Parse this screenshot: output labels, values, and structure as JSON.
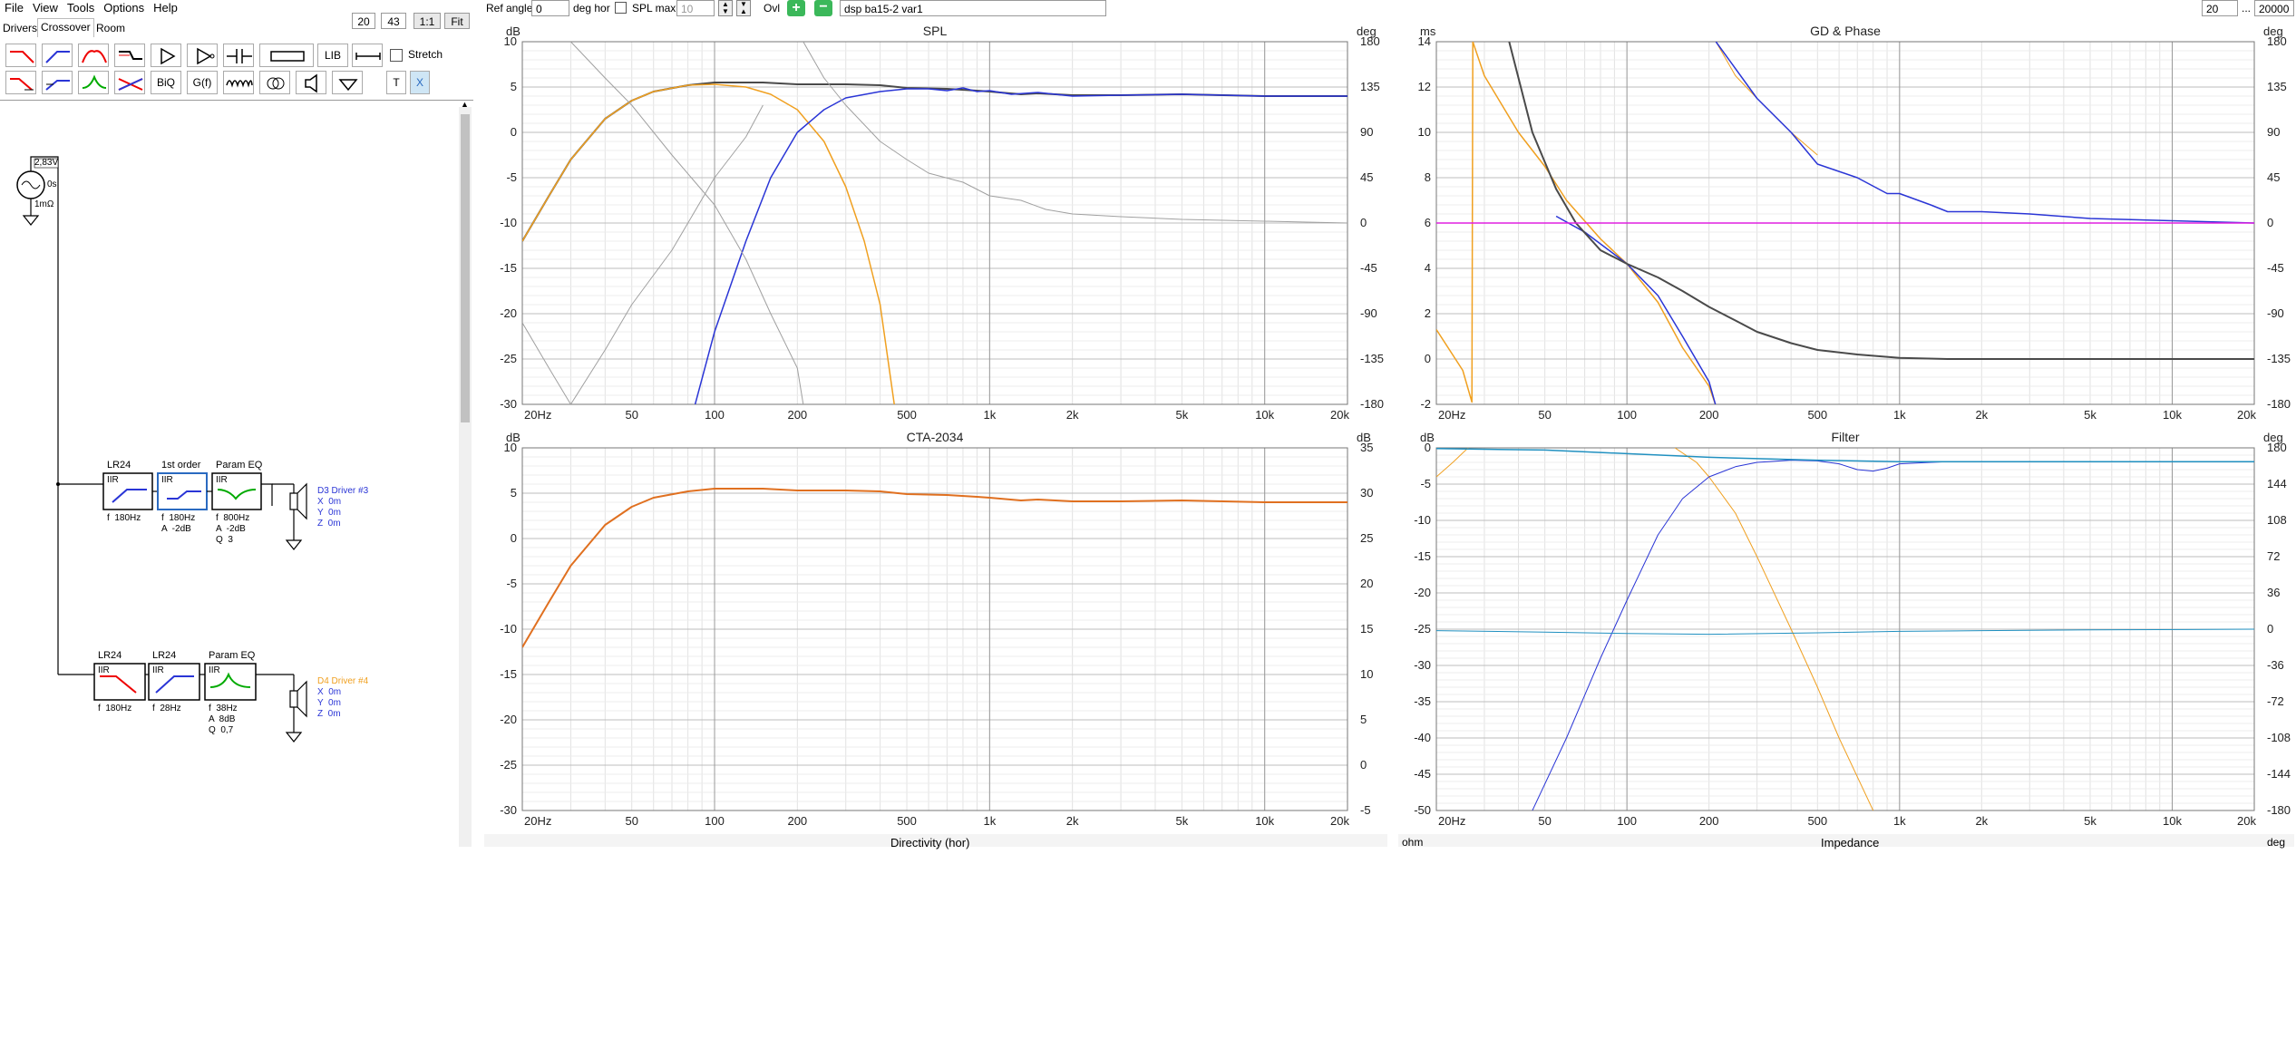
{
  "menu": [
    "File",
    "View",
    "Tools",
    "Options",
    "Help"
  ],
  "tabs": [
    "Drivers",
    "Crossover",
    "Room"
  ],
  "active_tab": "Crossover",
  "zoom": {
    "v1": "20",
    "v2": "43",
    "one_to_one": "1:1",
    "fit": "Fit"
  },
  "toolbar": {
    "lib": "LIB",
    "biq": "BiQ",
    "gf": "G(f)",
    "t": "T",
    "x": "X",
    "stretch": "Stretch"
  },
  "source": {
    "voltage": "2,83V",
    "delay": "0s",
    "resistance": "1mΩ"
  },
  "branch1": {
    "blocks": [
      {
        "title": "LR24",
        "type": "IIR",
        "p1": "f  180Hz",
        "p2": "",
        "p3": ""
      },
      {
        "title": "1st order",
        "type": "IIR",
        "p1": "f  180Hz",
        "p2": "A  -2dB",
        "p3": ""
      },
      {
        "title": "Param EQ",
        "type": "IIR",
        "p1": "f  800Hz",
        "p2": "A  -2dB",
        "p3": "Q  3"
      }
    ],
    "driver": {
      "name": "D3 Driver #3",
      "x": "X  0m",
      "y": "Y  0m",
      "z": "Z  0m",
      "color": "#2a35d6"
    }
  },
  "branch2": {
    "blocks": [
      {
        "title": "LR24",
        "type": "IIR",
        "p1": "f  180Hz",
        "p2": "",
        "p3": ""
      },
      {
        "title": "LR24",
        "type": "IIR",
        "p1": "f  28Hz",
        "p2": "",
        "p3": ""
      },
      {
        "title": "Param EQ",
        "type": "IIR",
        "p1": "f  38Hz",
        "p2": "A  8dB",
        "p3": "Q  0,7"
      }
    ],
    "driver": {
      "name": "D4 Driver #4",
      "x": "X  0m",
      "y": "Y  0m",
      "z": "Z  0m",
      "color": "#f0a020"
    }
  },
  "topbar": {
    "ref_angle_label": "Ref angle",
    "ref_angle_value": "0",
    "deg_hor": "deg hor",
    "spl_max": "SPL max",
    "spl_max_value": "10",
    "ovl": "Ovl",
    "project": "dsp ba15-2 var1",
    "f_min": "20",
    "ellipsis": "...",
    "f_max": "20000"
  },
  "bottom_titles": {
    "directivity": "Directivity (hor)",
    "impedance": "Impedance",
    "ohm": "ohm",
    "deg": "deg"
  },
  "colors": {
    "dark": "#4a4a4a",
    "blue": "#2a35d6",
    "orange": "#f0a020",
    "grey": "#a0a0a0",
    "ctaorange": "#e07020",
    "magenta": "#e020e0",
    "teal": "#2090c0",
    "navy": "#2a2a90"
  },
  "chart_data": [
    {
      "title": "SPL",
      "type": "line",
      "log_x": true,
      "xlim": [
        20,
        20000
      ],
      "ylim": [
        -30,
        10
      ],
      "y2lim": [
        -180,
        180
      ],
      "left_unit": "dB",
      "right_unit": "deg",
      "x_ticks": [
        "20Hz",
        "50",
        "100",
        "200",
        "500",
        "1k",
        "2k",
        "5k",
        "10k",
        "20k"
      ],
      "y_ticks": [
        "10",
        "5",
        "0",
        "-5",
        "-10",
        "-15",
        "-20",
        "-25",
        "-30"
      ],
      "y2_ticks": [
        "180",
        "135",
        "90",
        "45",
        "0",
        "-45",
        "-90",
        "-135",
        "-180"
      ],
      "series": [
        {
          "color": "#4a4a4a",
          "width": 2,
          "x": [
            20,
            25,
            30,
            40,
            50,
            60,
            80,
            100,
            150,
            200,
            300,
            400,
            500,
            700,
            900,
            1000,
            1300,
            1500,
            2000,
            3000,
            5000,
            10000,
            20000
          ],
          "y": [
            -12,
            -7,
            -3,
            1.5,
            3.5,
            4.5,
            5.2,
            5.5,
            5.5,
            5.3,
            5.3,
            5.2,
            4.9,
            4.8,
            4.6,
            4.5,
            4.2,
            4.3,
            4.1,
            4.1,
            4.2,
            4,
            4
          ]
        },
        {
          "color": "#f0a020",
          "width": 1.5,
          "x": [
            20,
            25,
            30,
            40,
            50,
            60,
            80,
            100,
            130,
            160,
            200,
            250,
            300,
            350,
            400,
            450
          ],
          "y": [
            -12,
            -7,
            -3,
            1.5,
            3.5,
            4.5,
            5.2,
            5.3,
            5,
            4.2,
            2.5,
            -1,
            -6,
            -12,
            -19,
            -30
          ]
        },
        {
          "color": "#2a35d6",
          "width": 1.5,
          "x": [
            85,
            100,
            130,
            160,
            200,
            250,
            300,
            400,
            500,
            600,
            700,
            800,
            900,
            1000,
            1200,
            1500,
            2000,
            3000,
            5000,
            10000,
            20000
          ],
          "y": [
            -30,
            -22,
            -12,
            -5,
            0,
            2.5,
            3.8,
            4.5,
            4.8,
            4.8,
            4.6,
            4.9,
            4.5,
            4.6,
            4.2,
            4.4,
            4.0,
            4.1,
            4.2,
            4,
            4
          ]
        },
        {
          "color": "#a0a0a0",
          "width": 1,
          "x": [
            20,
            25,
            30,
            40,
            50,
            70,
            100,
            130,
            150
          ],
          "y": [
            -21,
            -26,
            -30,
            -24,
            -19,
            -13,
            -5,
            -0.5,
            3
          ]
        },
        {
          "color": "#a0a0a0",
          "width": 1,
          "x": [
            30,
            40,
            50,
            70,
            100,
            130,
            160,
            200,
            210
          ],
          "y": [
            10,
            6,
            3,
            -2.5,
            -8,
            -14,
            -20,
            -26,
            -30
          ]
        },
        {
          "color": "#a0a0a0",
          "width": 1,
          "x": [
            210,
            250,
            300,
            400,
            500,
            600,
            800,
            1000,
            1300,
            1600,
            2000,
            3000,
            5000,
            10000,
            20000
          ],
          "y": [
            10,
            6,
            3,
            -1,
            -3,
            -4.5,
            -5.5,
            -7,
            -7.5,
            -8.5,
            -9,
            -9.3,
            -9.6,
            -9.8,
            -10
          ]
        }
      ]
    },
    {
      "title": "GD & Phase",
      "type": "line",
      "log_x": true,
      "xlim": [
        20,
        20000
      ],
      "ylim": [
        -2,
        14
      ],
      "y2lim": [
        -180,
        180
      ],
      "left_unit": "ms",
      "right_unit": "deg",
      "x_ticks": [
        "20Hz",
        "50",
        "100",
        "200",
        "500",
        "1k",
        "2k",
        "5k",
        "10k",
        "20k"
      ],
      "y_ticks": [
        "14",
        "12",
        "10",
        "8",
        "6",
        "4",
        "2",
        "0",
        "-2"
      ],
      "y2_ticks": [
        "180",
        "135",
        "90",
        "45",
        "0",
        "-45",
        "-90",
        "-135",
        "-180"
      ],
      "series": [
        {
          "color": "#f0a020",
          "width": 1.5,
          "x": [
            20,
            25,
            27,
            27.2,
            30,
            40,
            50,
            60,
            80,
            100,
            130,
            160,
            200,
            211
          ],
          "y": [
            1.3,
            -0.5,
            -1.9,
            14,
            12.5,
            10,
            8.5,
            7,
            5.3,
            4.2,
            2.5,
            0.5,
            -1.2,
            -2
          ]
        },
        {
          "color": "#f0a020",
          "width": 1,
          "x": [
            212,
            250,
            300,
            400,
            500
          ],
          "y": [
            14,
            12.5,
            11.5,
            10,
            9
          ]
        },
        {
          "color": "#2a35d6",
          "width": 1.5,
          "x": [
            55,
            70,
            100,
            130,
            160,
            200,
            211
          ],
          "y": [
            6.3,
            5.6,
            4.2,
            2.8,
            1,
            -1,
            -2
          ]
        },
        {
          "color": "#2a35d6",
          "width": 1.5,
          "x": [
            212,
            300,
            400,
            500,
            700,
            900,
            1000,
            1300,
            1500,
            2000,
            3000,
            5000,
            10000,
            20000
          ],
          "y": [
            14,
            11.5,
            10,
            8.6,
            8,
            7.3,
            7.3,
            6.8,
            6.5,
            6.5,
            6.4,
            6.2,
            6.1,
            6
          ]
        },
        {
          "color": "#4a4a4a",
          "width": 2,
          "x": [
            37,
            45,
            55,
            65,
            80,
            100,
            130,
            160,
            200,
            250,
            300,
            400,
            500,
            700,
            1000,
            1500,
            2000,
            5000,
            20000
          ],
          "y": [
            14,
            10,
            7.5,
            6,
            4.8,
            4.2,
            3.6,
            3,
            2.3,
            1.7,
            1.2,
            0.7,
            0.4,
            0.2,
            0.05,
            0,
            0,
            0,
            0
          ]
        },
        {
          "color": "#e020e0",
          "width": 1.5,
          "x": [
            20,
            20000
          ],
          "y": [
            6,
            6
          ]
        }
      ]
    },
    {
      "title": "CTA-2034",
      "type": "line",
      "log_x": true,
      "xlim": [
        20,
        20000
      ],
      "ylim": [
        -30,
        10
      ],
      "y2lim": [
        -5,
        35
      ],
      "left_unit": "dB",
      "right_unit": "dB",
      "x_ticks": [
        "20Hz",
        "50",
        "100",
        "200",
        "500",
        "1k",
        "2k",
        "5k",
        "10k",
        "20k"
      ],
      "y_ticks": [
        "10",
        "5",
        "0",
        "-5",
        "-10",
        "-15",
        "-20",
        "-25",
        "-30"
      ],
      "y2_ticks": [
        "35",
        "30",
        "25",
        "20",
        "15",
        "10",
        "5",
        "0",
        "-5"
      ],
      "series": [
        {
          "color": "#e07020",
          "width": 2,
          "x": [
            20,
            25,
            30,
            40,
            50,
            60,
            80,
            100,
            150,
            200,
            300,
            400,
            500,
            700,
            900,
            1000,
            1300,
            1500,
            2000,
            3000,
            5000,
            10000,
            20000
          ],
          "y": [
            -12,
            -7,
            -3,
            1.5,
            3.5,
            4.5,
            5.2,
            5.5,
            5.5,
            5.3,
            5.3,
            5.2,
            4.9,
            4.8,
            4.6,
            4.5,
            4.2,
            4.3,
            4.1,
            4.1,
            4.2,
            4,
            4
          ]
        }
      ]
    },
    {
      "title": "Filter",
      "type": "line",
      "log_x": true,
      "xlim": [
        20,
        20000
      ],
      "ylim": [
        -50,
        0
      ],
      "y2lim": [
        -180,
        180
      ],
      "left_unit": "dB",
      "right_unit": "deg",
      "x_ticks": [
        "20Hz",
        "50",
        "100",
        "200",
        "500",
        "1k",
        "2k",
        "5k",
        "10k",
        "20k"
      ],
      "y_ticks": [
        "0",
        "-5",
        "-10",
        "-15",
        "-20",
        "-25",
        "-30",
        "-35",
        "-40",
        "-45",
        "-50"
      ],
      "y2_ticks": [
        "180",
        "144",
        "108",
        "72",
        "36",
        "0",
        "-36",
        "-72",
        "-108",
        "-144",
        "-180"
      ],
      "series": [
        {
          "color": "#f0a020",
          "width": 1,
          "x": [
            20,
            23,
            27,
            30
          ],
          "y": [
            -4,
            -2,
            0.5,
            1.5
          ]
        },
        {
          "color": "#f0a020",
          "width": 1,
          "x": [
            150,
            180,
            200,
            250,
            300,
            400,
            500,
            600,
            800
          ],
          "y": [
            0,
            -2,
            -4,
            -9,
            -15,
            -25,
            -33,
            -40,
            -50
          ]
        },
        {
          "color": "#2a35d6",
          "width": 1,
          "x": [
            45,
            60,
            80,
            100,
            130,
            160,
            200,
            250,
            300,
            400,
            500,
            600,
            700,
            800,
            900,
            1000,
            1300,
            1500,
            2000,
            5000,
            20000
          ],
          "y": [
            -50,
            -40,
            -29,
            -21,
            -12,
            -7,
            -4,
            -2.6,
            -2,
            -1.7,
            -1.8,
            -2.2,
            -3,
            -3.2,
            -2.8,
            -2.2,
            -2,
            -1.9,
            -1.9,
            -1.9,
            -1.9
          ]
        },
        {
          "color": "#2090c0",
          "width": 1.5,
          "x": [
            20,
            50,
            100,
            200,
            500,
            1000,
            2000,
            5000,
            20000
          ],
          "y": [
            -0.1,
            -0.3,
            -0.8,
            -1.3,
            -1.7,
            -1.9,
            -1.9,
            -1.9,
            -1.9
          ]
        },
        {
          "color": "#2090c0",
          "width": 1,
          "x": [
            20,
            50,
            100,
            200,
            500,
            1000,
            2000,
            5000,
            20000
          ],
          "y": [
            -25.2,
            -25.4,
            -25.6,
            -25.7,
            -25.5,
            -25.3,
            -25.2,
            -25.1,
            -25
          ]
        }
      ]
    }
  ]
}
